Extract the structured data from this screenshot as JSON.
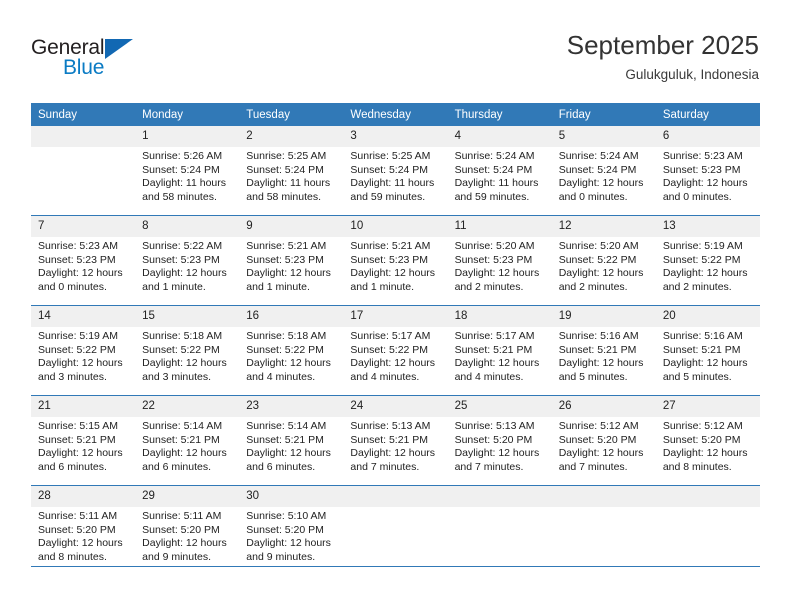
{
  "brand": {
    "name_top": "General",
    "name_bottom": "Blue",
    "colors": {
      "accent": "#1268b3",
      "blue_text": "#0a7bc4",
      "header_blue": "#3179b7"
    }
  },
  "header": {
    "title": "September 2025",
    "subtitle": "Gulukguluk, Indonesia"
  },
  "weekday_headers": [
    "Sunday",
    "Monday",
    "Tuesday",
    "Wednesday",
    "Thursday",
    "Friday",
    "Saturday"
  ],
  "labels": {
    "sunrise_prefix": "Sunrise:",
    "sunset_prefix": "Sunset:",
    "daylight_prefix": "Daylight:"
  },
  "weeks": [
    [
      {
        "day": "",
        "blank": true
      },
      {
        "day": "1",
        "sunrise": "Sunrise: 5:26 AM",
        "sunset": "Sunset: 5:24 PM",
        "daylight": "Daylight: 11 hours and 58 minutes."
      },
      {
        "day": "2",
        "sunrise": "Sunrise: 5:25 AM",
        "sunset": "Sunset: 5:24 PM",
        "daylight": "Daylight: 11 hours and 58 minutes."
      },
      {
        "day": "3",
        "sunrise": "Sunrise: 5:25 AM",
        "sunset": "Sunset: 5:24 PM",
        "daylight": "Daylight: 11 hours and 59 minutes."
      },
      {
        "day": "4",
        "sunrise": "Sunrise: 5:24 AM",
        "sunset": "Sunset: 5:24 PM",
        "daylight": "Daylight: 11 hours and 59 minutes."
      },
      {
        "day": "5",
        "sunrise": "Sunrise: 5:24 AM",
        "sunset": "Sunset: 5:24 PM",
        "daylight": "Daylight: 12 hours and 0 minutes."
      },
      {
        "day": "6",
        "sunrise": "Sunrise: 5:23 AM",
        "sunset": "Sunset: 5:23 PM",
        "daylight": "Daylight: 12 hours and 0 minutes."
      }
    ],
    [
      {
        "day": "7",
        "sunrise": "Sunrise: 5:23 AM",
        "sunset": "Sunset: 5:23 PM",
        "daylight": "Daylight: 12 hours and 0 minutes."
      },
      {
        "day": "8",
        "sunrise": "Sunrise: 5:22 AM",
        "sunset": "Sunset: 5:23 PM",
        "daylight": "Daylight: 12 hours and 1 minute."
      },
      {
        "day": "9",
        "sunrise": "Sunrise: 5:21 AM",
        "sunset": "Sunset: 5:23 PM",
        "daylight": "Daylight: 12 hours and 1 minute."
      },
      {
        "day": "10",
        "sunrise": "Sunrise: 5:21 AM",
        "sunset": "Sunset: 5:23 PM",
        "daylight": "Daylight: 12 hours and 1 minute."
      },
      {
        "day": "11",
        "sunrise": "Sunrise: 5:20 AM",
        "sunset": "Sunset: 5:23 PM",
        "daylight": "Daylight: 12 hours and 2 minutes."
      },
      {
        "day": "12",
        "sunrise": "Sunrise: 5:20 AM",
        "sunset": "Sunset: 5:22 PM",
        "daylight": "Daylight: 12 hours and 2 minutes."
      },
      {
        "day": "13",
        "sunrise": "Sunrise: 5:19 AM",
        "sunset": "Sunset: 5:22 PM",
        "daylight": "Daylight: 12 hours and 2 minutes."
      }
    ],
    [
      {
        "day": "14",
        "sunrise": "Sunrise: 5:19 AM",
        "sunset": "Sunset: 5:22 PM",
        "daylight": "Daylight: 12 hours and 3 minutes."
      },
      {
        "day": "15",
        "sunrise": "Sunrise: 5:18 AM",
        "sunset": "Sunset: 5:22 PM",
        "daylight": "Daylight: 12 hours and 3 minutes."
      },
      {
        "day": "16",
        "sunrise": "Sunrise: 5:18 AM",
        "sunset": "Sunset: 5:22 PM",
        "daylight": "Daylight: 12 hours and 4 minutes."
      },
      {
        "day": "17",
        "sunrise": "Sunrise: 5:17 AM",
        "sunset": "Sunset: 5:22 PM",
        "daylight": "Daylight: 12 hours and 4 minutes."
      },
      {
        "day": "18",
        "sunrise": "Sunrise: 5:17 AM",
        "sunset": "Sunset: 5:21 PM",
        "daylight": "Daylight: 12 hours and 4 minutes."
      },
      {
        "day": "19",
        "sunrise": "Sunrise: 5:16 AM",
        "sunset": "Sunset: 5:21 PM",
        "daylight": "Daylight: 12 hours and 5 minutes."
      },
      {
        "day": "20",
        "sunrise": "Sunrise: 5:16 AM",
        "sunset": "Sunset: 5:21 PM",
        "daylight": "Daylight: 12 hours and 5 minutes."
      }
    ],
    [
      {
        "day": "21",
        "sunrise": "Sunrise: 5:15 AM",
        "sunset": "Sunset: 5:21 PM",
        "daylight": "Daylight: 12 hours and 6 minutes."
      },
      {
        "day": "22",
        "sunrise": "Sunrise: 5:14 AM",
        "sunset": "Sunset: 5:21 PM",
        "daylight": "Daylight: 12 hours and 6 minutes."
      },
      {
        "day": "23",
        "sunrise": "Sunrise: 5:14 AM",
        "sunset": "Sunset: 5:21 PM",
        "daylight": "Daylight: 12 hours and 6 minutes."
      },
      {
        "day": "24",
        "sunrise": "Sunrise: 5:13 AM",
        "sunset": "Sunset: 5:21 PM",
        "daylight": "Daylight: 12 hours and 7 minutes."
      },
      {
        "day": "25",
        "sunrise": "Sunrise: 5:13 AM",
        "sunset": "Sunset: 5:20 PM",
        "daylight": "Daylight: 12 hours and 7 minutes."
      },
      {
        "day": "26",
        "sunrise": "Sunrise: 5:12 AM",
        "sunset": "Sunset: 5:20 PM",
        "daylight": "Daylight: 12 hours and 7 minutes."
      },
      {
        "day": "27",
        "sunrise": "Sunrise: 5:12 AM",
        "sunset": "Sunset: 5:20 PM",
        "daylight": "Daylight: 12 hours and 8 minutes."
      }
    ],
    [
      {
        "day": "28",
        "sunrise": "Sunrise: 5:11 AM",
        "sunset": "Sunset: 5:20 PM",
        "daylight": "Daylight: 12 hours and 8 minutes."
      },
      {
        "day": "29",
        "sunrise": "Sunrise: 5:11 AM",
        "sunset": "Sunset: 5:20 PM",
        "daylight": "Daylight: 12 hours and 9 minutes."
      },
      {
        "day": "30",
        "sunrise": "Sunrise: 5:10 AM",
        "sunset": "Sunset: 5:20 PM",
        "daylight": "Daylight: 12 hours and 9 minutes."
      },
      {
        "day": "",
        "blank": true
      },
      {
        "day": "",
        "blank": true
      },
      {
        "day": "",
        "blank": true
      },
      {
        "day": "",
        "blank": true
      }
    ]
  ]
}
